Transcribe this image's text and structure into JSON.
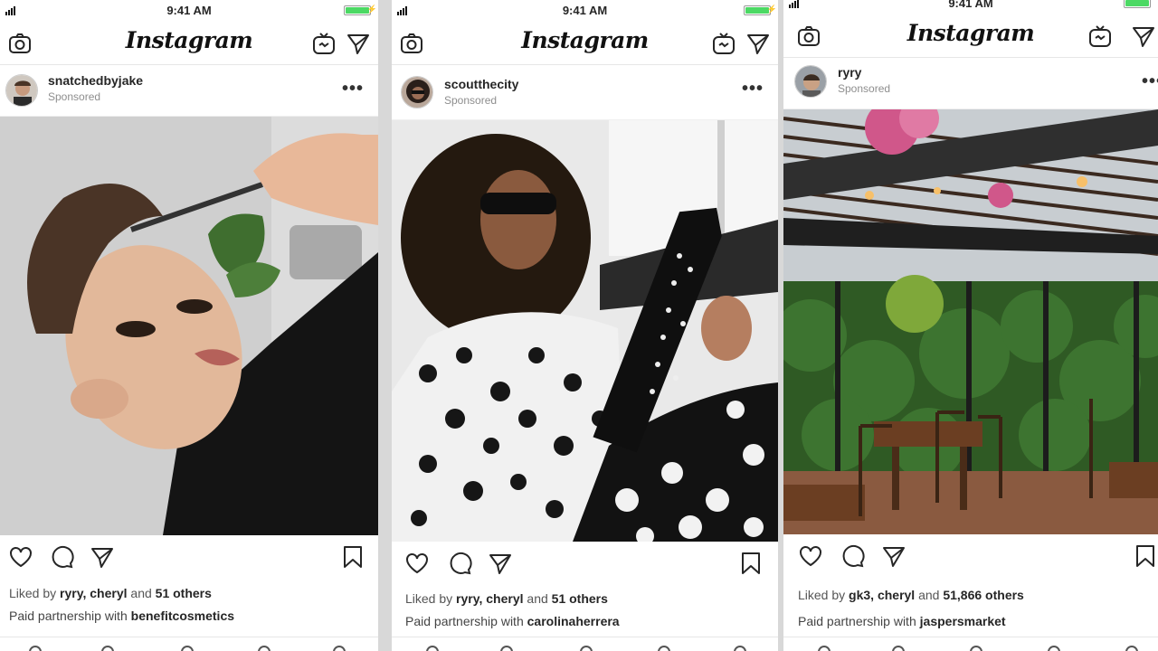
{
  "status_bar": {
    "time": "9:41 AM"
  },
  "app": {
    "logo_text": "Instagram"
  },
  "colors": {
    "battery": "#4cd964",
    "meta_text": "#8e8e8e",
    "brand_text": "#262626"
  },
  "icons": [
    "camera-icon",
    "igtv-icon",
    "direct-message-icon",
    "more-options-icon",
    "heart-icon",
    "comment-icon",
    "share-icon",
    "bookmark-icon"
  ],
  "posts": [
    {
      "username": "snatchedbyjake",
      "sponsored_label": "Sponsored",
      "more_label": "•••",
      "likes_prefix": "Liked by",
      "likes_users": "ryry, cheryl",
      "likes_and": "and",
      "likes_others": "51 others",
      "partner_prefix": "Paid partnership with",
      "partner_name": "benefitcosmetics"
    },
    {
      "username": "scoutthecity",
      "sponsored_label": "Sponsored",
      "more_label": "•••",
      "likes_prefix": "Liked by",
      "likes_users": "ryry, cheryl",
      "likes_and": "and",
      "likes_others": "51 others",
      "partner_prefix": "Paid partnership with",
      "partner_name": "carolinaherrera"
    },
    {
      "username": "ryry",
      "sponsored_label": "Sponsored",
      "more_label": "•••",
      "likes_prefix": "Liked by",
      "likes_users": "gk3, cheryl",
      "likes_and": "and",
      "likes_others": "51,866 others",
      "partner_prefix": "Paid partnership with",
      "partner_name": "jaspersmarket"
    }
  ]
}
